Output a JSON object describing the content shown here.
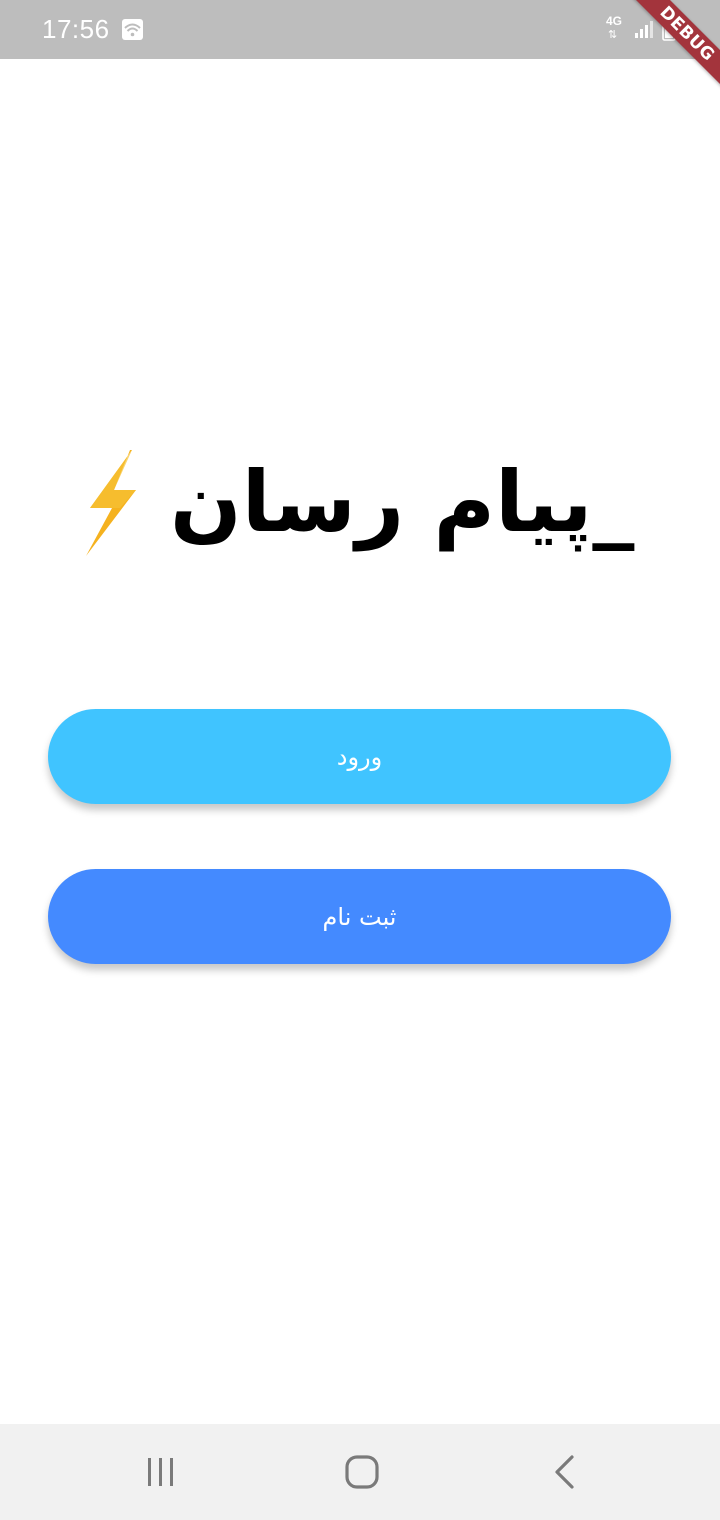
{
  "status_bar": {
    "time": "17:56",
    "network": "4G",
    "network_arrows": "⇅",
    "icons": [
      "wifi-icon",
      "signal-icon",
      "battery-icon"
    ]
  },
  "debug_banner": {
    "label": "DEBUG"
  },
  "app": {
    "title": "_پیام رسان",
    "logo_icon": "lightning-bolt-icon"
  },
  "buttons": {
    "login_label": "ورود",
    "signup_label": "ثبت نام"
  },
  "navigation_bar": {
    "icons": [
      "recent-apps-icon",
      "home-icon",
      "back-icon"
    ]
  },
  "colors": {
    "status_bar": "#bdbdbd",
    "login_button": "#40c4ff",
    "signup_button": "#448aff",
    "bolt": "#f5b21f",
    "debug_banner": "#a3343c",
    "nav_bar": "#f1f1f1"
  }
}
